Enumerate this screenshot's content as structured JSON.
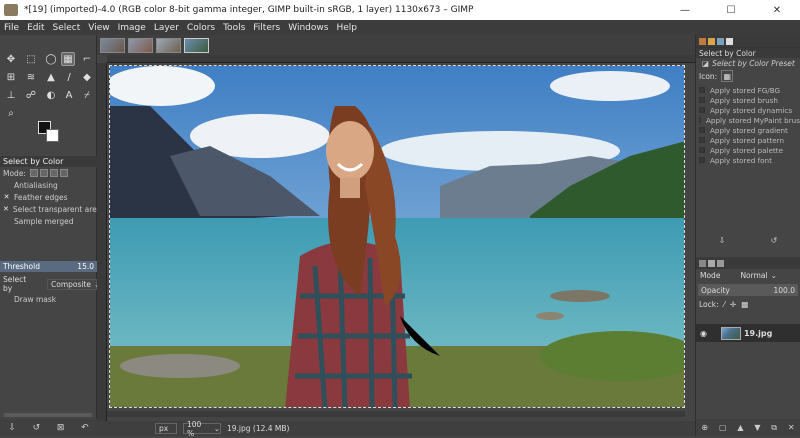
{
  "window": {
    "title": "*[19] (imported)-4.0 (RGB color 8-bit gamma integer, GIMP built-in sRGB, 1 layer) 1130x673 – GIMP",
    "minimize": "—",
    "maximize": "☐",
    "close": "✕"
  },
  "menu": [
    "File",
    "Edit",
    "Select",
    "View",
    "Image",
    "Layer",
    "Colors",
    "Tools",
    "Filters",
    "Windows",
    "Help"
  ],
  "toolbox": {
    "tools": [
      {
        "name": "move-tool-icon",
        "glyph": "✥"
      },
      {
        "name": "rect-select-icon",
        "glyph": "⬚"
      },
      {
        "name": "lasso-icon",
        "glyph": "◯"
      },
      {
        "name": "select-by-color-icon",
        "glyph": "▦"
      },
      {
        "name": "crop-icon",
        "glyph": "⌐"
      },
      {
        "name": "transform-icon",
        "glyph": "⊞"
      },
      {
        "name": "warp-icon",
        "glyph": "≋"
      },
      {
        "name": "bucket-fill-icon",
        "glyph": "▲"
      },
      {
        "name": "paintbrush-icon",
        "glyph": "/"
      },
      {
        "name": "eraser-icon",
        "glyph": "◆"
      },
      {
        "name": "clone-icon",
        "glyph": "⊥"
      },
      {
        "name": "smudge-icon",
        "glyph": "☍"
      },
      {
        "name": "dodge-icon",
        "glyph": "◐"
      },
      {
        "name": "text-icon",
        "glyph": "A"
      },
      {
        "name": "color-picker-icon",
        "glyph": "⌿"
      },
      {
        "name": "zoom-icon",
        "glyph": "⌕"
      }
    ]
  },
  "tool_options": {
    "title": "Select by Color",
    "mode_label": "Mode:",
    "options": [
      {
        "label": "Antialiasing",
        "checked": false
      },
      {
        "label": "Feather edges",
        "checked": true
      },
      {
        "label": "Select transparent areas",
        "checked": true
      },
      {
        "label": "Sample merged",
        "checked": false
      }
    ],
    "threshold_label": "Threshold",
    "threshold_value": "15.0",
    "select_by_label": "Select by",
    "select_by_value": "Composite",
    "draw_mask_label": "Draw mask"
  },
  "left_bottom_icons": [
    "⇩",
    "↺",
    "⊠",
    "↶"
  ],
  "image_tabs": 4,
  "status": {
    "unit": "px",
    "zoom": "100 %",
    "file_info": "19.jpg (12.4 MB)"
  },
  "right_panel": {
    "header": "Select by Color",
    "sub_header": "Select by Color Preset",
    "icon_label": "Icon:",
    "presets": [
      "Apply stored FG/BG",
      "Apply stored brush",
      "Apply stored dynamics",
      "Apply stored MyPaint brush",
      "Apply stored gradient",
      "Apply stored pattern",
      "Apply stored palette",
      "Apply stored font"
    ],
    "mode_label": "Mode",
    "mode_value": "Normal",
    "opacity_label": "Opacity",
    "opacity_value": "100.0",
    "lock_label": "Lock:",
    "layer_name": "19.jpg"
  }
}
